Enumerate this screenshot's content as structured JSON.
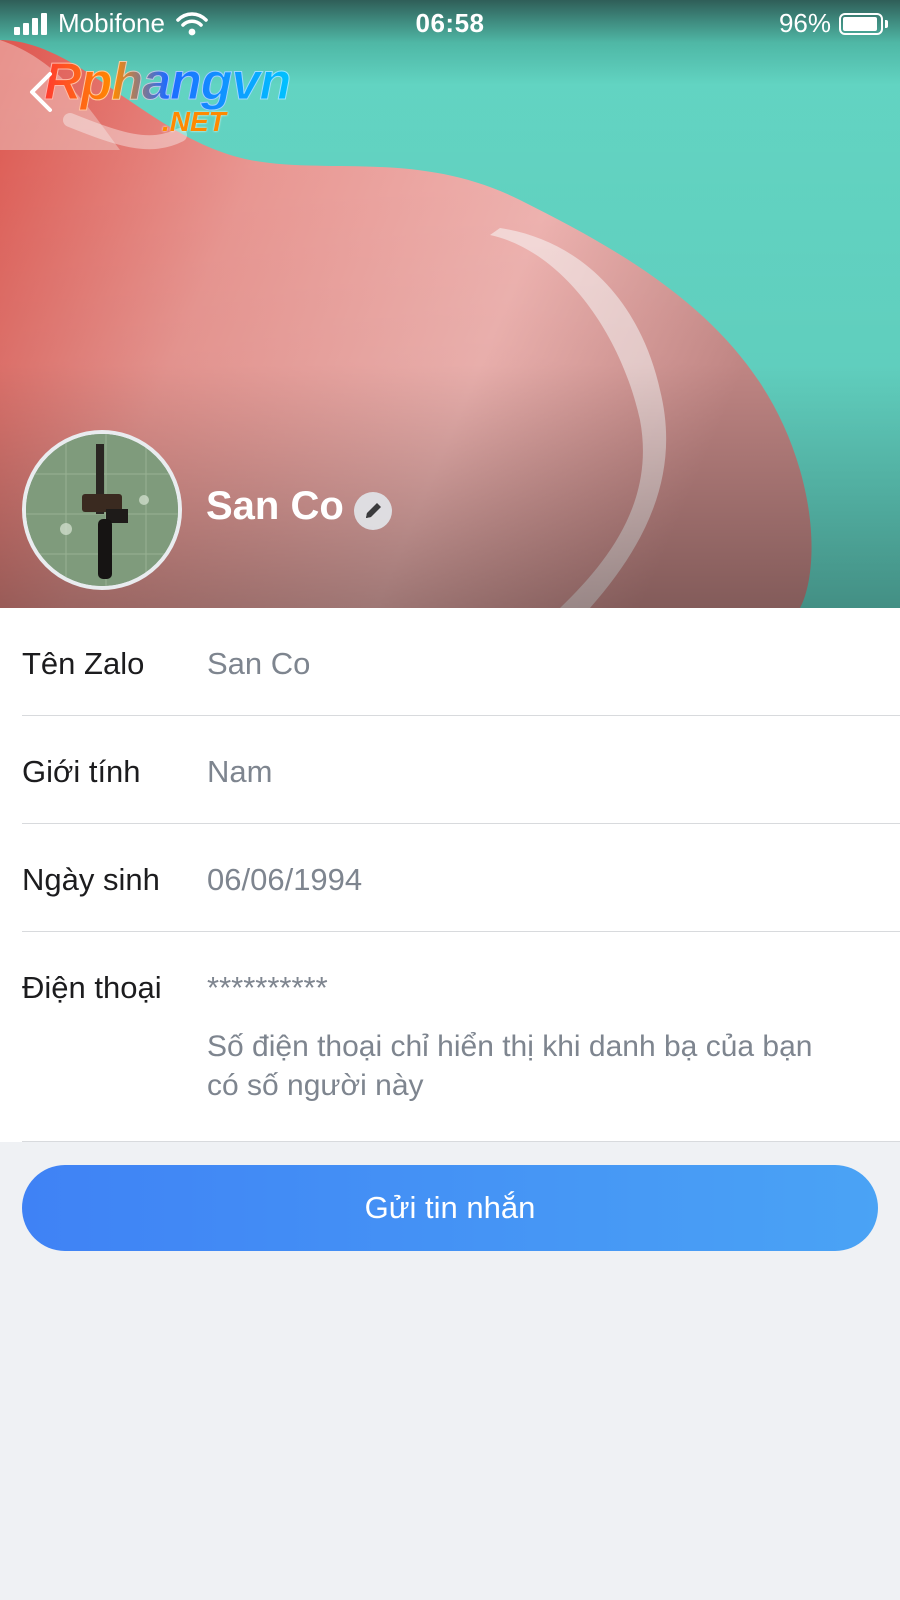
{
  "status_bar": {
    "carrier": "Mobifone",
    "time": "06:58",
    "battery": "96%",
    "battery_level": 0.96
  },
  "watermark": {
    "main": "Rphangvn",
    "sub": ".NET"
  },
  "profile": {
    "name": "San Co"
  },
  "info": {
    "rows": [
      {
        "label": "Tên Zalo",
        "value": "San Co"
      },
      {
        "label": "Giới tính",
        "value": "Nam"
      },
      {
        "label": "Ngày sinh",
        "value": "06/06/1994"
      },
      {
        "label": "Điện thoại",
        "value": "**********",
        "note": "Số điện thoại chỉ hiển thị khi danh bạ của bạn có số người này"
      }
    ]
  },
  "actions": {
    "send_message_label": "Gửi tin nhắn"
  },
  "colors": {
    "accent": "#3f82f5",
    "cover_teal": "#67dccb",
    "cover_pink": "#f0a9a7"
  },
  "icons": [
    "signal-icon",
    "wifi-icon",
    "battery-icon",
    "back-arrow-icon",
    "pencil-icon"
  ]
}
